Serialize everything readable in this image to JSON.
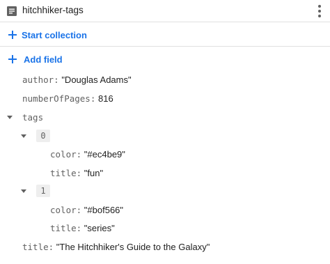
{
  "header": {
    "title": "hitchhiker-tags",
    "doc_icon": "document-icon",
    "menu_icon": "more-vert-icon"
  },
  "actions": {
    "start_collection": "Start collection",
    "add_field": "Add field"
  },
  "fields": {
    "author": {
      "key": "author",
      "value": "\"Douglas Adams\""
    },
    "numberOfPages": {
      "key": "numberOfPages",
      "value": "816"
    },
    "tags": {
      "key": "tags",
      "items": [
        {
          "index": "0",
          "color": {
            "key": "color",
            "value": "\"#ec4be9\""
          },
          "title": {
            "key": "title",
            "value": "\"fun\""
          }
        },
        {
          "index": "1",
          "color": {
            "key": "color",
            "value": "\"#bof566\""
          },
          "title": {
            "key": "title",
            "value": "\"series\""
          }
        }
      ]
    },
    "title": {
      "key": "title",
      "value": "\"The Hitchhiker's Guide to the Galaxy\""
    }
  },
  "colon": ":",
  "colors": {
    "accent": "#1a73e8",
    "divider": "#e0e0e0",
    "chip": "#eeeeee"
  }
}
